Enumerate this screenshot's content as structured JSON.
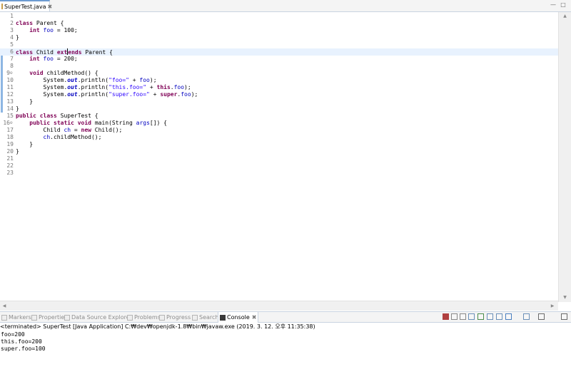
{
  "editor": {
    "tab": {
      "label": "SuperTest.java",
      "close": "✖"
    },
    "window_controls": {
      "minimize": "—",
      "maximize": "□"
    },
    "lines": [
      [],
      [
        {
          "t": "class",
          "c": "kw"
        },
        {
          "t": " Parent {"
        }
      ],
      [
        {
          "t": "    "
        },
        {
          "t": "int",
          "c": "kw"
        },
        {
          "t": " "
        },
        {
          "t": "foo",
          "c": "fld"
        },
        {
          "t": " = 100;"
        }
      ],
      [
        {
          "t": "}"
        }
      ],
      [],
      [
        {
          "t": "class",
          "c": "kw"
        },
        {
          "t": " Child "
        },
        {
          "t": "ext",
          "c": "kw"
        },
        {
          "caret": true
        },
        {
          "t": "ends",
          "c": "kw"
        },
        {
          "t": " Parent {"
        }
      ],
      [
        {
          "t": "    "
        },
        {
          "t": "int",
          "c": "kw"
        },
        {
          "t": " "
        },
        {
          "t": "foo",
          "c": "fld"
        },
        {
          "t": " = 200;"
        }
      ],
      [],
      [
        {
          "t": "    "
        },
        {
          "t": "void",
          "c": "kw"
        },
        {
          "t": " childMethod() {"
        }
      ],
      [
        {
          "t": "        System."
        },
        {
          "t": "out",
          "c": "sfld"
        },
        {
          "t": ".println("
        },
        {
          "t": "\"foo=\"",
          "c": "str"
        },
        {
          "t": " + "
        },
        {
          "t": "foo",
          "c": "fld"
        },
        {
          "t": ");"
        }
      ],
      [
        {
          "t": "        System."
        },
        {
          "t": "out",
          "c": "sfld"
        },
        {
          "t": ".println("
        },
        {
          "t": "\"this.foo=\"",
          "c": "str"
        },
        {
          "t": " + "
        },
        {
          "t": "this",
          "c": "kw"
        },
        {
          "t": "."
        },
        {
          "t": "foo",
          "c": "fld"
        },
        {
          "t": ");"
        }
      ],
      [
        {
          "t": "        System."
        },
        {
          "t": "out",
          "c": "sfld"
        },
        {
          "t": ".println("
        },
        {
          "t": "\"super.foo=\"",
          "c": "str"
        },
        {
          "t": " + "
        },
        {
          "t": "super",
          "c": "kw"
        },
        {
          "t": "."
        },
        {
          "t": "foo",
          "c": "fld"
        },
        {
          "t": ");"
        }
      ],
      [
        {
          "t": "    }"
        }
      ],
      [
        {
          "t": "}"
        }
      ],
      [
        {
          "t": "public",
          "c": "kw"
        },
        {
          "t": " "
        },
        {
          "t": "class",
          "c": "kw"
        },
        {
          "t": " SuperTest {"
        }
      ],
      [
        {
          "t": "    "
        },
        {
          "t": "public",
          "c": "kw"
        },
        {
          "t": " "
        },
        {
          "t": "static",
          "c": "kw"
        },
        {
          "t": " "
        },
        {
          "t": "void",
          "c": "kw"
        },
        {
          "t": " main(String "
        },
        {
          "t": "args",
          "c": "fld"
        },
        {
          "t": "[]) {"
        }
      ],
      [
        {
          "t": "        Child "
        },
        {
          "t": "ch",
          "c": "fld"
        },
        {
          "t": " = "
        },
        {
          "t": "new",
          "c": "kw"
        },
        {
          "t": " Child();"
        }
      ],
      [
        {
          "t": "        "
        },
        {
          "t": "ch",
          "c": "fld"
        },
        {
          "t": ".childMethod();"
        }
      ],
      [
        {
          "t": "    }"
        }
      ],
      [
        {
          "t": "}"
        }
      ],
      [],
      [],
      []
    ],
    "fold_marker": "⊖",
    "fold_lines": [
      9,
      16
    ],
    "current_line": 6,
    "changed_lines": [
      6,
      7,
      8,
      9,
      10,
      11,
      12,
      13,
      14
    ]
  },
  "views": {
    "tabs": [
      {
        "label": "Markers",
        "icon": "markers-icon",
        "active": false
      },
      {
        "label": "Properties",
        "icon": "properties-icon",
        "active": false
      },
      {
        "label": "Data Source Explorer",
        "icon": "data-source-explorer-icon",
        "active": false
      },
      {
        "label": "Problems",
        "icon": "problems-icon",
        "active": false
      },
      {
        "label": "Progress",
        "icon": "progress-icon",
        "active": false
      },
      {
        "label": "Search",
        "icon": "search-icon",
        "active": false
      },
      {
        "label": "Console",
        "icon": "console-icon",
        "active": true
      }
    ],
    "console_close": "✖",
    "toolbar_icons": [
      "terminate-icon",
      "remove-launch-icon",
      "remove-all-terminated-icon",
      "scroll-lock-icon",
      "show-console-on-output-icon",
      "word-wrap-icon",
      "pin-console-icon",
      "display-selected-console-icon",
      "open-console-icon",
      "minimize-view-icon",
      "maximize-view-icon"
    ]
  },
  "console": {
    "status": "<terminated> SuperTest [Java Application] C:₩dev₩openjdk-1.8₩bin₩javaw.exe (2019. 3. 12. 오후 11:35:38)",
    "output": [
      "foo=200",
      "this.foo=200",
      "super.foo=100"
    ]
  }
}
